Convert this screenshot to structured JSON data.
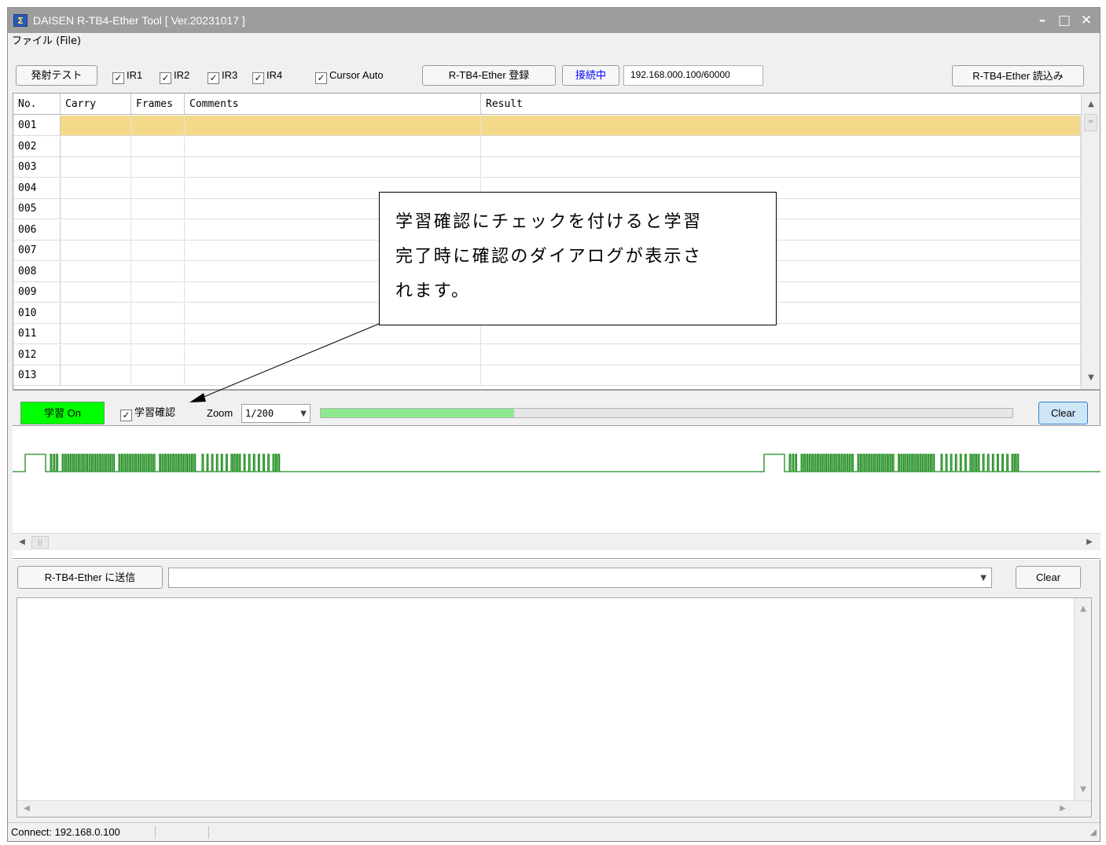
{
  "window": {
    "title": "DAISEN R-TB4-Ether Tool  [ Ver.20231017 ]",
    "icon": "app-icon",
    "controls": [
      "–",
      "□",
      "✕"
    ]
  },
  "menu": {
    "file": "ファイル (File)"
  },
  "toolbar": {
    "fire_test": "発射テスト",
    "ir1": "IR1",
    "ir2": "IR2",
    "ir3": "IR3",
    "ir4": "IR4",
    "cursor_auto": "Cursor Auto",
    "register": "R-TB4-Ether 登録",
    "status": "接続中",
    "address": "192.168.000.100/60000",
    "read": "R-TB4-Ether 読込み"
  },
  "grid": {
    "columns": [
      "No.",
      "Carry",
      "Frames",
      "Comments",
      "Result"
    ],
    "rows": [
      "001",
      "002",
      "003",
      "004",
      "005",
      "006",
      "007",
      "008",
      "009",
      "010",
      "011",
      "012",
      "013"
    ],
    "selected_row": "001"
  },
  "learn": {
    "button": "学習 On",
    "confirm": "学習確認",
    "zoom_label": "Zoom",
    "zoom_value": "1/200",
    "progress": 0.28,
    "clear": "Clear"
  },
  "send": {
    "button": "R-TB4-Ether に送信",
    "input_value": "",
    "clear": "Clear"
  },
  "status": {
    "connect": "Connect: 192.168.0.100"
  },
  "callout": {
    "line1": "学習確認にチェックを付けると学習",
    "line2": "完了時に確認のダイアログが表示さ",
    "line3": "れます。"
  },
  "colors": {
    "titlebar": "#9d9d9d",
    "selected_row": "#f5d98a",
    "learn_on": "#00ff00",
    "status_text": "#0000ff",
    "waveform": "#1a8a1a",
    "progress": "#8ee88e"
  }
}
